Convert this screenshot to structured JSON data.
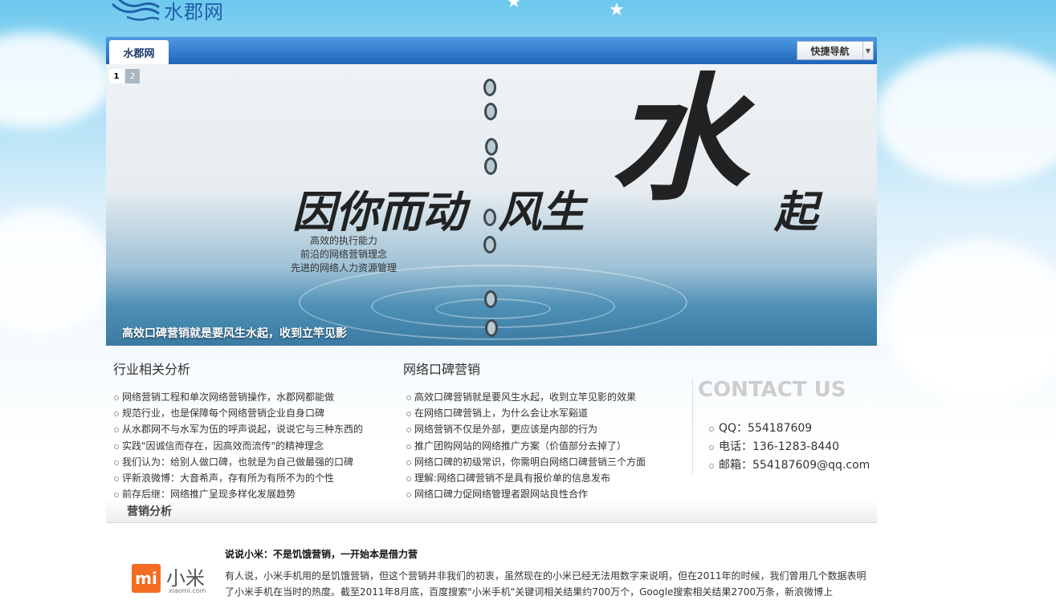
{
  "site": {
    "logo_text": "水郡网"
  },
  "tabbar": {
    "active_tab": "水郡网",
    "quicknav_label": "快捷导航"
  },
  "banner": {
    "pages": [
      "1",
      "2"
    ],
    "headline_left": "因你而动",
    "headline_mid": "风生",
    "headline_big": "水",
    "headline_end": "起",
    "sub_lines": [
      "高效的执行能力",
      "前沿的网络营销理念",
      "先进的网络人力资源管理"
    ],
    "caption": "高效口碑营销就是要风生水起，收到立竿见影"
  },
  "industry": {
    "title": "行业相关分析",
    "items": [
      "网络营销工程和单次网络营销操作，水郡网都能做",
      "规范行业，也是保障每个网络营销企业自身口碑",
      "从水郡网不与水军为伍的呼声说起，说说它与三种东西的",
      "实践\"因诚信而存在，因高效而流传\"的精神理念",
      "我们认为：给别人做口碑，也就是为自己做最强的口碑",
      "评新浪微博：大音希声，存有所为有所不为的个性",
      "前存后继：网络推广呈现多样化发展趋势"
    ]
  },
  "wom": {
    "title": "网络口碑营销",
    "items": [
      "高效口碑营销就是要风生水起，收到立竿见影的效果",
      "在网络口碑营销上，为什么会让水军谿道",
      "网络营销不仅是外部，更应该是内部的行为",
      "推广团购网站的网络推广方案（价值部分去掉了）",
      "网络口碑的初级常识，你需明白网络口碑营销三个方面",
      "理解:网络口碑营销不是具有报价单的信息发布",
      "网络口碑力促网络管理者跟网站良性合作"
    ]
  },
  "contact": {
    "title": "CONTACT US",
    "items": [
      "QQ：554187609",
      "电话：136-1283-8440",
      "邮箱：554187609@qq.com"
    ]
  },
  "marketing": {
    "section_title": "营销分析",
    "logo_mi": "mi",
    "logo_cn": "小米",
    "logo_en": "xiaomi.com",
    "article_title": "说说小米：不是饥饿营销，一开始本是借力营",
    "article_body": "有人说，小米手机用的是饥饿营销，但这个营销并非我们的初衷，虽然现在的小米已经无法用数字来说明，但在2011年的时候，我们曾用几个数据表明了小米手机在当时的热度。截至2011年8月底，百度搜索\"小米手机\"关键词相关结果约700万个，Google搜索相关结果2700万条，新浪微博上"
  }
}
